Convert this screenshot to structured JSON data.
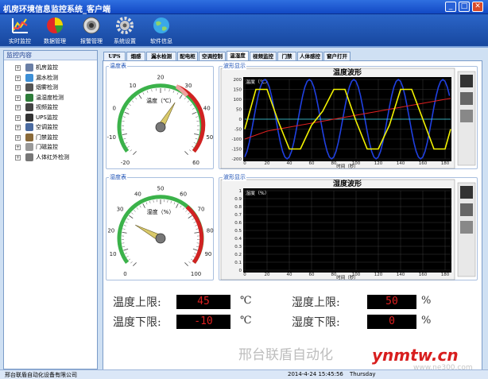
{
  "window": {
    "title": "机房环境信息监控系统_客户端"
  },
  "toolbar": {
    "items": [
      {
        "label": "实时监控",
        "icon": "chart-icon"
      },
      {
        "label": "数据管理",
        "icon": "pie-chart-icon"
      },
      {
        "label": "报警管理",
        "icon": "speaker-icon"
      },
      {
        "label": "系统设置",
        "icon": "gear-icon"
      },
      {
        "label": "软件信息",
        "icon": "globe-icon"
      }
    ]
  },
  "sidebar": {
    "header": "监控内容",
    "items": [
      {
        "label": "机房监控",
        "color": "#6a7fa6"
      },
      {
        "label": "漏水检测",
        "color": "#3d8fd6"
      },
      {
        "label": "烟雾检测",
        "color": "#555555"
      },
      {
        "label": "温湿度检测",
        "color": "#2e7d3a"
      },
      {
        "label": "视频监控",
        "color": "#444444"
      },
      {
        "label": "UPS监控",
        "color": "#333333"
      },
      {
        "label": "空调监控",
        "color": "#4a6aa0"
      },
      {
        "label": "门禁监控",
        "color": "#8a6a3a"
      },
      {
        "label": "门磁监控",
        "color": "#999999"
      },
      {
        "label": "人体红外检测",
        "color": "#777777"
      }
    ]
  },
  "tabs": [
    {
      "label": "UPS",
      "selected": false
    },
    {
      "label": "烟感",
      "selected": false
    },
    {
      "label": "漏水检测",
      "selected": false
    },
    {
      "label": "配电柜",
      "selected": false
    },
    {
      "label": "空调控制",
      "selected": false
    },
    {
      "label": "温湿度",
      "selected": true
    },
    {
      "label": "视频监控",
      "selected": false
    },
    {
      "label": "门禁",
      "selected": false
    },
    {
      "label": "人体感控",
      "selected": false
    },
    {
      "label": "窗户打开",
      "selected": false
    }
  ],
  "temp_gauge": {
    "group_label": "温度表",
    "title": "温度（℃）",
    "ticks": [
      "-20",
      "-10",
      "0",
      "10",
      "20",
      "30",
      "40",
      "50",
      "60"
    ],
    "min": -20,
    "max": 60,
    "value": 29
  },
  "hum_gauge": {
    "group_label": "湿度表",
    "title": "湿度（%）",
    "ticks": [
      "0",
      "10",
      "20",
      "30",
      "40",
      "50",
      "60",
      "70",
      "80",
      "90",
      "100"
    ],
    "min": 0,
    "max": 100,
    "value": 27
  },
  "temp_wave": {
    "group_label": "波形显示",
    "title": "温度波形",
    "ylabel": "温度（℃）",
    "xlabel": "时间（秒）",
    "yticks": [
      "200",
      "150",
      "100",
      "50",
      "0",
      "-50",
      "-100",
      "-150",
      "-200"
    ],
    "xticks": [
      "0",
      "20",
      "40",
      "60",
      "80",
      "100",
      "120",
      "140",
      "160",
      "180"
    ]
  },
  "hum_wave": {
    "group_label": "波形显示",
    "title": "湿度波形",
    "ylabel": "湿度（%）",
    "xlabel": "时间（秒）",
    "yticks": [
      "1",
      "0.9",
      "0.8",
      "0.7",
      "0.6",
      "0.5",
      "0.4",
      "0.3",
      "0.2",
      "0.1",
      "0"
    ],
    "xticks": [
      "0",
      "20",
      "40",
      "60",
      "80",
      "100",
      "120",
      "140",
      "160",
      "180"
    ]
  },
  "limits": {
    "temp_upper_label": "温度上限:",
    "temp_upper_value": "45",
    "temp_unit": "℃",
    "temp_lower_label": "温度下限:",
    "temp_lower_value": "-10",
    "hum_upper_label": "湿度上限:",
    "hum_upper_value": "50",
    "hum_unit": "%",
    "hum_lower_label": "湿度下限:",
    "hum_lower_value": "0"
  },
  "statusbar": {
    "company": "邢台联盾自动化设备有限公司",
    "datetime": "2014-4-24 15:45:56",
    "weekday": "Thursday"
  },
  "watermark": {
    "text": "邢台联盾自动化",
    "brand": "ynmtw.cn",
    "site": "www.ne300.com"
  },
  "colors": {
    "gauge_green": "#3bb24a",
    "gauge_red": "#d02222",
    "trace_yellow": "#f2f200",
    "trace_blue": "#2040e0",
    "trace_red": "#e02020",
    "trace_cyan": "#3fd8e8"
  },
  "chart_data": [
    {
      "type": "line",
      "title": "温度波形",
      "xlabel": "时间（秒）",
      "ylabel": "温度（℃）",
      "xlim": [
        0,
        190
      ],
      "ylim": [
        -200,
        200
      ],
      "series": [
        {
          "x": [
            0,
            10,
            20,
            30,
            40,
            50,
            60,
            70,
            80,
            90,
            100,
            110,
            120,
            130,
            140,
            150,
            160,
            170,
            180,
            185
          ],
          "values": [
            -50,
            150,
            150,
            -10,
            -150,
            -150,
            -30,
            40,
            150,
            150,
            -10,
            -150,
            -150,
            -30,
            150,
            150,
            0,
            -150,
            -150,
            -50
          ]
        },
        {
          "x": [
            0,
            20,
            40,
            60,
            80,
            100,
            120,
            140,
            160,
            180,
            185
          ],
          "values": [
            -100,
            -60,
            -40,
            -20,
            0,
            20,
            40,
            60,
            80,
            100,
            105
          ]
        },
        {
          "x": [
            0,
            185
          ],
          "values": [
            0,
            0
          ]
        }
      ]
    },
    {
      "type": "line",
      "title": "湿度波形",
      "xlabel": "时间（秒）",
      "ylabel": "湿度（%）",
      "xlim": [
        0,
        190
      ],
      "ylim": [
        0,
        1
      ],
      "series": []
    }
  ]
}
